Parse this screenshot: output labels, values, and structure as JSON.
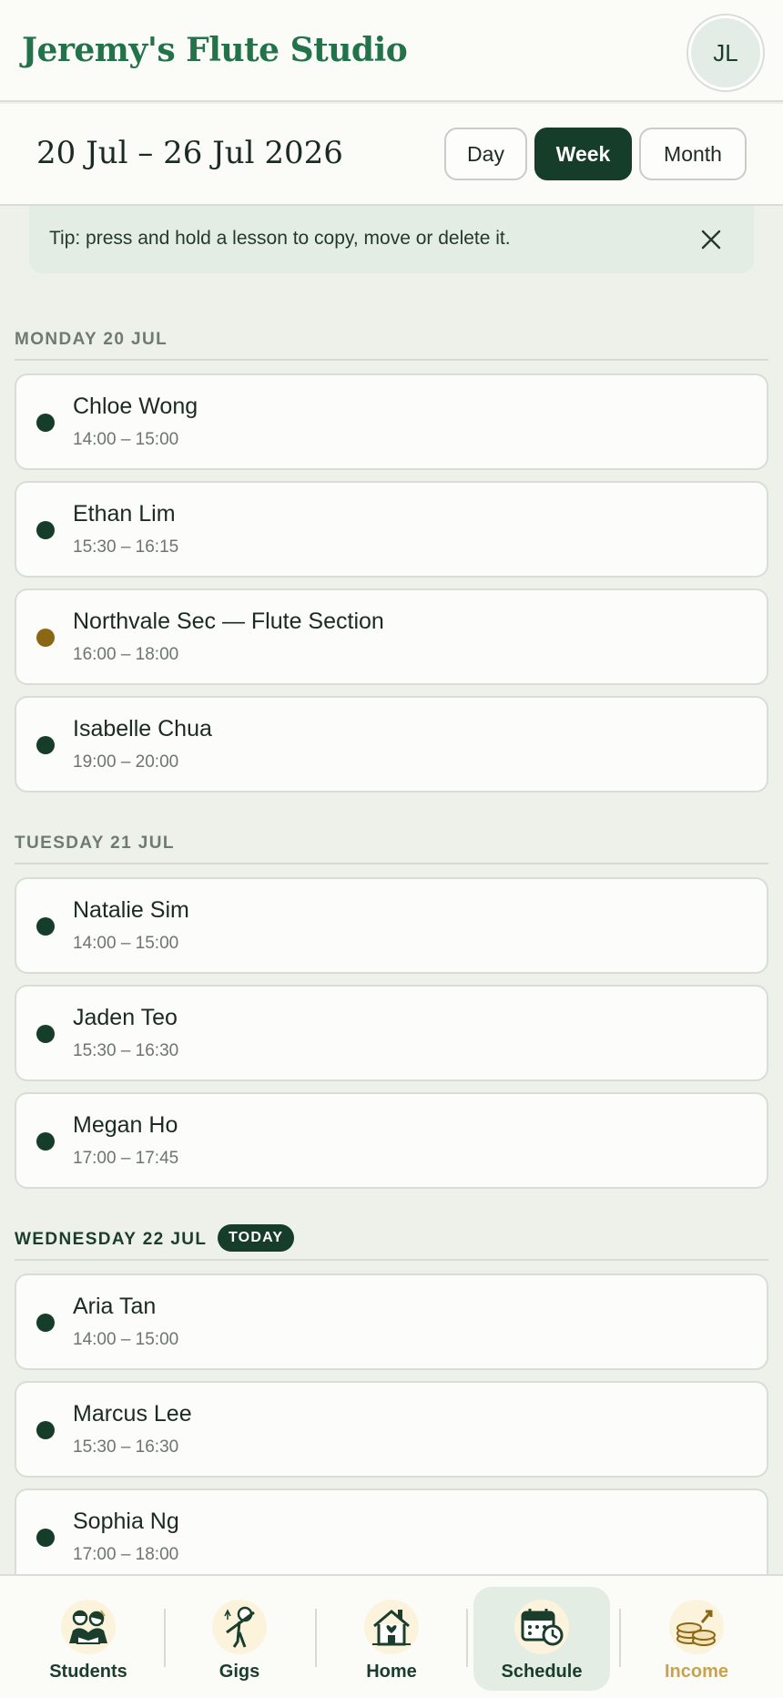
{
  "header": {
    "title": "Jeremy's Flute Studio",
    "avatar_initials": "JL"
  },
  "week": {
    "range": "20 Jul – 26 Jul 2026",
    "views": [
      "Day",
      "Week",
      "Month"
    ],
    "active_view": "Week"
  },
  "tip": {
    "text": "Tip: press and hold a lesson to copy, move or delete it."
  },
  "days": [
    {
      "label": "MONDAY 20 JUL",
      "lessons": [
        {
          "name": "Chloe Wong",
          "time": "14:00 – 15:00",
          "dot": "#163d2a"
        },
        {
          "name": "Ethan Lim",
          "time": "15:30 – 16:15",
          "dot": "#163d2a"
        },
        {
          "name": "Northvale Sec — Flute Section",
          "time": "16:00 – 18:00",
          "dot": "#8a6714"
        },
        {
          "name": "Isabelle Chua",
          "time": "19:00 – 20:00",
          "dot": "#163d2a"
        }
      ]
    },
    {
      "label": "TUESDAY 21 JUL",
      "lessons": [
        {
          "name": "Natalie Sim",
          "time": "14:00 – 15:00",
          "dot": "#163d2a"
        },
        {
          "name": "Jaden Teo",
          "time": "15:30 – 16:30",
          "dot": "#163d2a"
        },
        {
          "name": "Megan Ho",
          "time": "17:00 – 17:45",
          "dot": "#163d2a"
        }
      ]
    },
    {
      "label": "WEDNESDAY 22 JUL",
      "badge": "TODAY",
      "lessons": [
        {
          "name": "Aria Tan",
          "time": "14:00 – 15:00",
          "dot": "#163d2a"
        },
        {
          "name": "Marcus Lee",
          "time": "15:30 – 16:30",
          "dot": "#163d2a"
        },
        {
          "name": "Sophia Ng",
          "time": "17:00 – 18:00",
          "dot": "#163d2a"
        }
      ]
    }
  ],
  "nav": [
    {
      "label": "Students",
      "icon": "students-icon"
    },
    {
      "label": "Gigs",
      "icon": "flute-player-icon"
    },
    {
      "label": "Home",
      "icon": "house-icon"
    },
    {
      "label": "Schedule",
      "icon": "calendar-clock-icon",
      "active": true
    },
    {
      "label": "Income",
      "icon": "coins-icon",
      "highlight": "#c9a24d"
    }
  ]
}
